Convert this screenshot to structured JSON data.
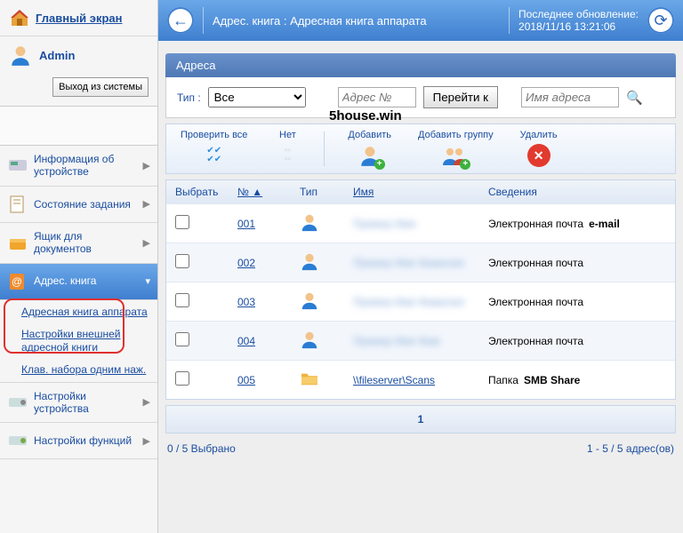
{
  "sidebar": {
    "home": "Главный экран",
    "user": "Admin",
    "logout": "Выход из системы",
    "items": [
      {
        "label": "Информация об устройстве"
      },
      {
        "label": "Состояние задания"
      },
      {
        "label": "Ящик для документов"
      },
      {
        "label": "Адрес. книга"
      },
      {
        "label": "Настройки устройства"
      },
      {
        "label": "Настройки функций"
      }
    ],
    "sub_items": [
      "Адресная книга аппарата",
      "Настройки внешней адресной книги",
      "Клав. набора одним наж."
    ]
  },
  "topbar": {
    "breadcrumb": "Адрес. книга : Адресная книга аппарата",
    "last_update_label": "Последнее обновление:",
    "last_update_value": "2018/11/16 13:21:06"
  },
  "section_title": "Адреса",
  "filter": {
    "type_label": "Тип :",
    "type_value": "Все",
    "addr_no_placeholder": "Адрес №",
    "goto": "Перейти к",
    "name_placeholder": "Имя адреса"
  },
  "toolbar": {
    "check_all": "Проверить все",
    "none": "Нет",
    "add": "Добавить",
    "add_group": "Добавить группу",
    "delete": "Удалить"
  },
  "table": {
    "headers": {
      "select": "Выбрать",
      "no": "№",
      "type": "Тип",
      "name": "Имя",
      "details": "Сведения"
    },
    "rows": [
      {
        "no": "001",
        "type": "person",
        "name_blurred": true,
        "name": "Пример Имя",
        "details": "Электронная почта",
        "extra": "e-mail"
      },
      {
        "no": "002",
        "type": "person",
        "name_blurred": true,
        "name": "Пример Имя Фамилия",
        "details": "Электронная почта",
        "extra": ""
      },
      {
        "no": "003",
        "type": "person",
        "name_blurred": true,
        "name": "Пример Имя Фамилия",
        "details": "Электронная почта",
        "extra": ""
      },
      {
        "no": "004",
        "type": "person",
        "name_blurred": true,
        "name": "Пример Имя Фам",
        "details": "Электронная почта",
        "extra": ""
      },
      {
        "no": "005",
        "type": "folder",
        "name_blurred": false,
        "name": "\\\\fileserver\\Scans",
        "details": "Папка",
        "extra": "SMB Share"
      }
    ]
  },
  "pager": {
    "page": "1"
  },
  "status": {
    "selected": "0 / 5 Выбрано",
    "range": "1 - 5 / 5 адрес(ов)"
  },
  "watermark": "5house.win"
}
